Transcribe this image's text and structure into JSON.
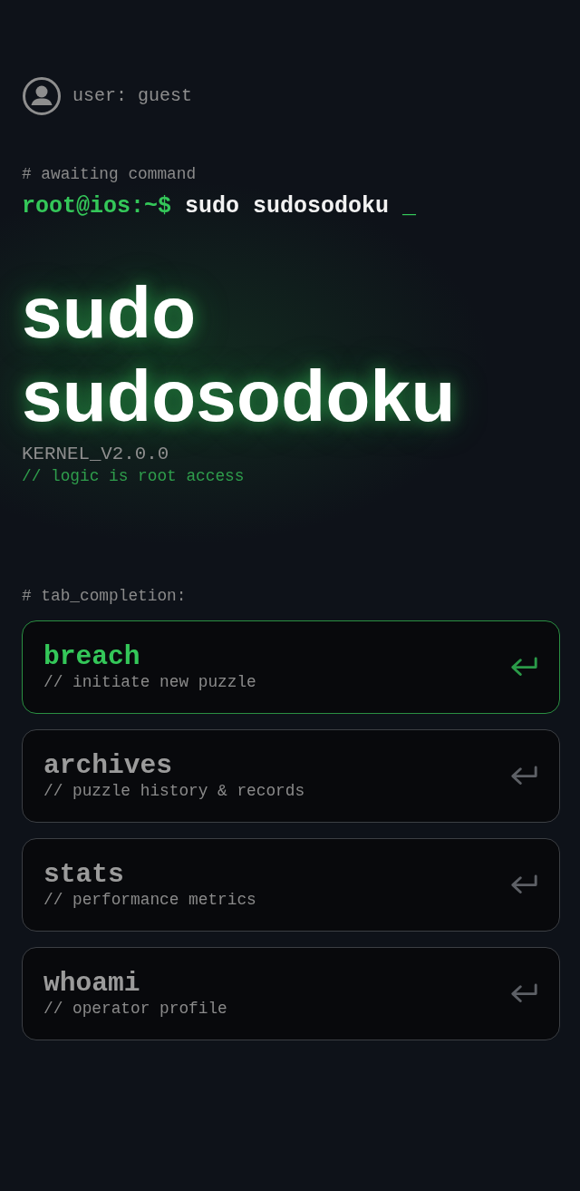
{
  "user": {
    "label": "user: guest"
  },
  "terminal": {
    "comment": "# awaiting command",
    "prompt": "root@ios:~$",
    "command": "sudo sudosodoku",
    "cursor": "_"
  },
  "hero": {
    "title": "sudo sudosodoku",
    "version": "KERNEL_V2.0.0",
    "tagline": "// logic is root access"
  },
  "menu": {
    "heading": "# tab_completion:",
    "items": [
      {
        "command": "breach",
        "description": "// initiate new puzzle",
        "selected": true
      },
      {
        "command": "archives",
        "description": "// puzzle history & records",
        "selected": false
      },
      {
        "command": "stats",
        "description": "// performance metrics",
        "selected": false
      },
      {
        "command": "whoami",
        "description": "// operator profile",
        "selected": false
      }
    ]
  }
}
